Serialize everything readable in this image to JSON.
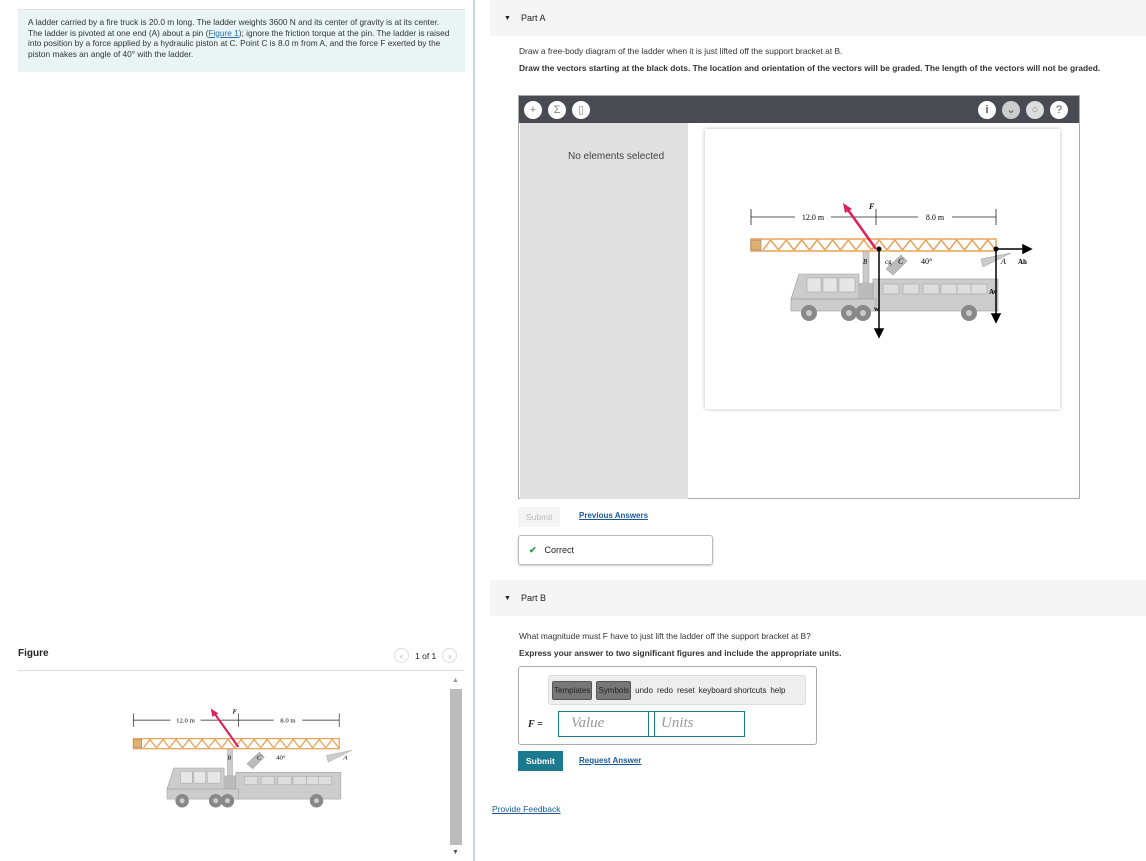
{
  "problem": {
    "text_before": "A ladder carried by a fire truck is 20.0 m long. The ladder weights 3600 N and its center of gravity is at its center. The ladder is pivoted at one end (A) about a pin (",
    "figure_link": "Figure 1",
    "text_after": "); ignore the friction torque at the pin. The ladder is raised into position by a force applied by a hydraulic piston at C. Point C is 8.0 m from A, and the force F exerted by the piston makes an angle of 40° with the ladder."
  },
  "figure": {
    "title": "Figure",
    "pager": "1 of 1"
  },
  "diagram": {
    "dim_left": "12.0 m",
    "dim_right": "8.0 m",
    "F": "F",
    "B": "B",
    "C": "C",
    "A": "A",
    "cg": "cg",
    "angle": "40°",
    "Ah": "Ah",
    "Av": "Av",
    "w": "w"
  },
  "partA": {
    "label": "Part A",
    "instruction1": "Draw a free-body diagram of the ladder when it is just lifted off the support bracket at B.",
    "instruction2": "Draw the vectors starting at the black dots. The location and orientation of the vectors will be graded. The length of the vectors will not be graded.",
    "no_selection": "No elements selected",
    "submit": "Submit",
    "previous_answers": "Previous Answers",
    "correct": "Correct"
  },
  "partB": {
    "label": "Part B",
    "question": "What magnitude must F have to just lift the ladder off the support bracket at B?",
    "instruction": "Express your answer to two significant figures and include the appropriate units.",
    "templates": "Templates",
    "symbols": "Symbols",
    "undo": "undo",
    "redo": "redo",
    "reset": "reset",
    "shortcuts": "keyboard shortcuts",
    "help": "help",
    "var_label": "F =",
    "value_placeholder": "Value",
    "units_placeholder": "Units",
    "submit": "Submit",
    "request_answer": "Request Answer"
  },
  "feedback": "Provide Feedback",
  "colors": {
    "ladder": "#e8a25a",
    "force": "#e0205a",
    "submit": "#1b7a90",
    "correct": "#2a9a4a"
  }
}
